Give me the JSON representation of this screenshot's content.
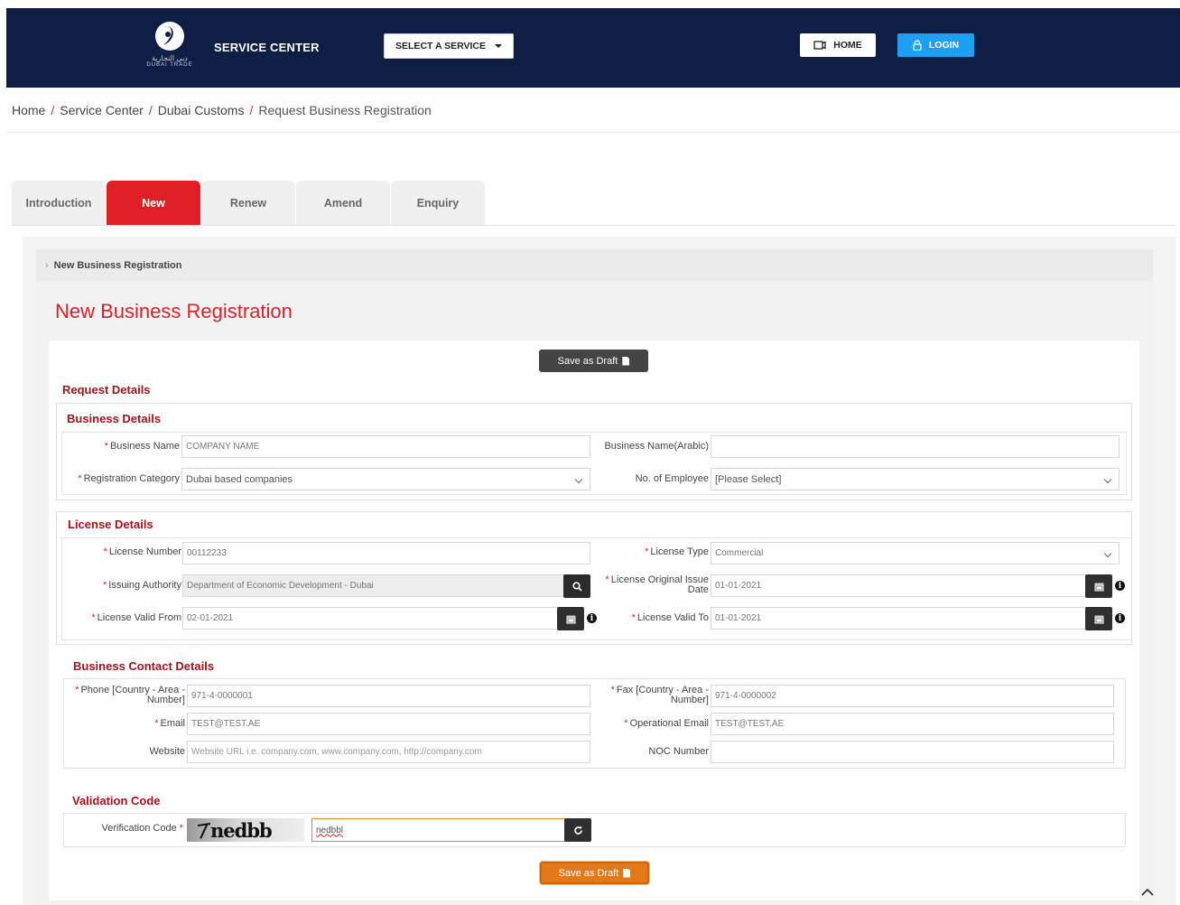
{
  "header": {
    "logo_ar": "ﺩﺑﻲ ﺍﻟﺘﺠﺎﺭﻳﺔ",
    "logo_en": "DUBAI TRADE",
    "service_center": "SERVICE CENTER",
    "select_service": "SELECT A SERVICE",
    "home": "HOME",
    "login": "LOGIN"
  },
  "breadcrumb": {
    "home": "Home",
    "service_center": "Service Center",
    "dubai_customs": "Dubai Customs",
    "current": "Request Business Registration",
    "separator": "/"
  },
  "tabs": [
    "Introduction",
    "New",
    "Renew",
    "Amend",
    "Enquiry"
  ],
  "accordion_title": "New Business Registration",
  "page_title": "New Business Registration",
  "save_draft": "Save as Draft",
  "sections": {
    "request_details": "Request Details",
    "business_details": "Business Details",
    "license_details": "License Details",
    "contact_details": "Business Contact Details",
    "validation_code": "Validation Code"
  },
  "business": {
    "name_label": "Business Name",
    "name_value": "COMPANY NAME",
    "name_ar_label": "Business Name(Arabic)",
    "name_ar_value": "",
    "reg_cat_label": "Registration Category",
    "reg_cat_value": "Dubai based companies",
    "employees_label": "No. of Employee",
    "employees_value": "[Please Select]"
  },
  "license": {
    "number_label": "License Number",
    "number_value": "00112233",
    "type_label": "License Type",
    "type_value": "Commercial",
    "authority_label": "Issuing Authority",
    "authority_value": "Department of Economic Development - Dubai",
    "issue_label_1": "License Original Issue",
    "issue_label_2": "Date",
    "issue_value": "01-01-2021",
    "valid_from_label": "License Valid From",
    "valid_from_value": "02-01-2021",
    "valid_to_label": "License Valid To",
    "valid_to_value": "01-01-2021"
  },
  "contact": {
    "phone_label_1": "Phone [Country - Area -",
    "phone_label_2": "Number]",
    "phone_value": "971-4-0000001",
    "fax_label_1": "Fax [Country - Area -",
    "fax_label_2": "Number]",
    "fax_value": "971-4-0000002",
    "email_label": "Email",
    "email_value": "TEST@TEST.AE",
    "op_email_label": "Operational Email",
    "op_email_value": "TEST@TEST.AE",
    "website_label": "Website",
    "website_placeholder": "Website URL i.e. company.com, www.company.com, http://company.com",
    "noc_label": "NOC Number",
    "noc_value": ""
  },
  "validation": {
    "label": "Verification Code",
    "captcha_text": "nedbb",
    "code_value": "nedbbl"
  },
  "colors": {
    "header_bg": "#0f1e45",
    "accent_red": "#e01e26",
    "section_red": "#a8101b",
    "login_blue": "#1e9ef5",
    "draft_orange": "#e27a1a"
  }
}
